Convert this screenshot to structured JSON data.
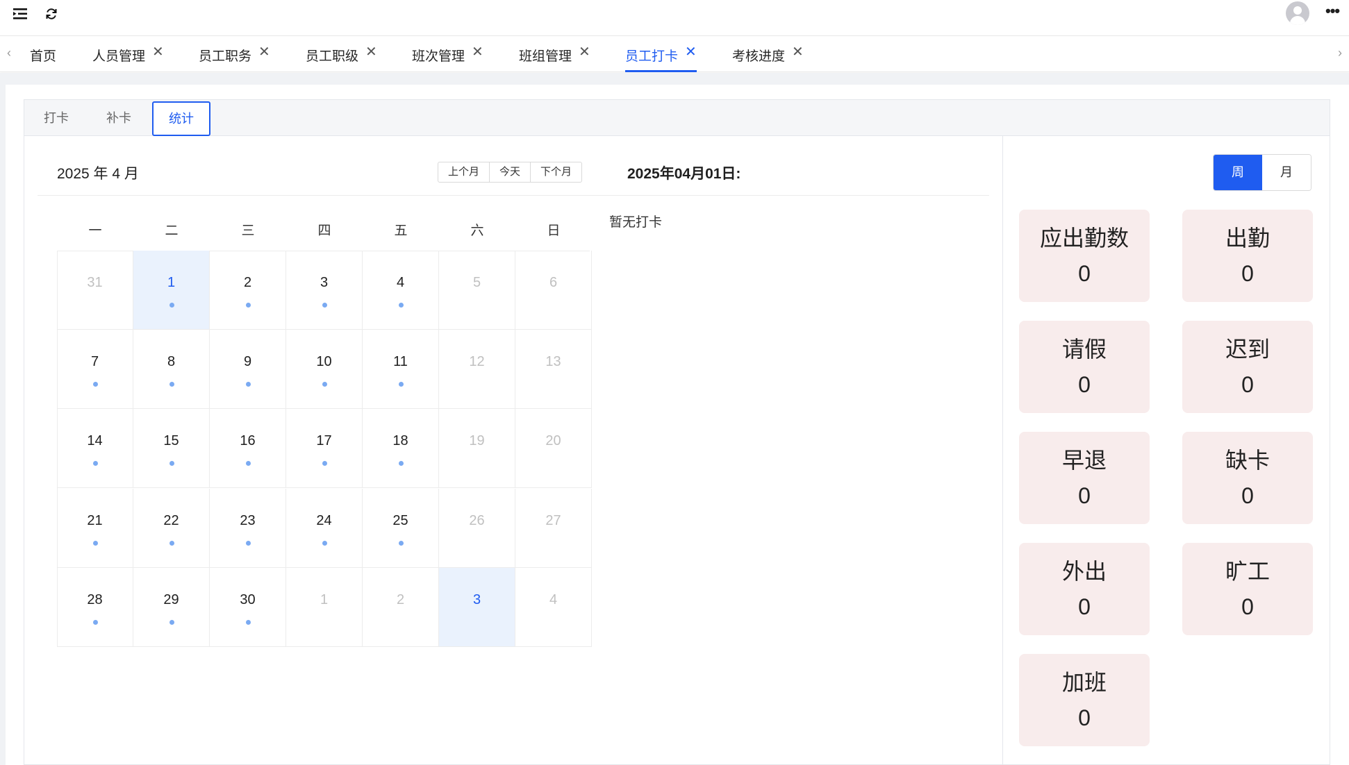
{
  "tabs": {
    "items": [
      {
        "label": "首页",
        "closable": false
      },
      {
        "label": "人员管理",
        "closable": true
      },
      {
        "label": "员工职务",
        "closable": true
      },
      {
        "label": "员工职级",
        "closable": true
      },
      {
        "label": "班次管理",
        "closable": true
      },
      {
        "label": "班组管理",
        "closable": true
      },
      {
        "label": "员工打卡",
        "closable": true,
        "active": true
      },
      {
        "label": "考核进度",
        "closable": true
      }
    ],
    "close_glyph": "✕",
    "prev_glyph": "‹",
    "next_glyph": "›"
  },
  "subtabs": [
    "打卡",
    "补卡",
    "统计"
  ],
  "subtab_active": "统计",
  "calendar": {
    "title": "2025 年 4 月",
    "prev_label": "上个月",
    "today_label": "今天",
    "next_label": "下个月",
    "weekdays": [
      "一",
      "二",
      "三",
      "四",
      "五",
      "六",
      "日"
    ],
    "weeks": [
      [
        {
          "d": "31",
          "muted": true
        },
        {
          "d": "1",
          "dot": true,
          "selected": true
        },
        {
          "d": "2",
          "dot": true
        },
        {
          "d": "3",
          "dot": true
        },
        {
          "d": "4",
          "dot": true
        },
        {
          "d": "5",
          "muted": true
        },
        {
          "d": "6",
          "muted": true
        }
      ],
      [
        {
          "d": "7",
          "dot": true
        },
        {
          "d": "8",
          "dot": true
        },
        {
          "d": "9",
          "dot": true
        },
        {
          "d": "10",
          "dot": true
        },
        {
          "d": "11",
          "dot": true
        },
        {
          "d": "12",
          "muted": true
        },
        {
          "d": "13",
          "muted": true
        }
      ],
      [
        {
          "d": "14",
          "dot": true
        },
        {
          "d": "15",
          "dot": true
        },
        {
          "d": "16",
          "dot": true
        },
        {
          "d": "17",
          "dot": true
        },
        {
          "d": "18",
          "dot": true
        },
        {
          "d": "19",
          "muted": true
        },
        {
          "d": "20",
          "muted": true
        }
      ],
      [
        {
          "d": "21",
          "dot": true
        },
        {
          "d": "22",
          "dot": true
        },
        {
          "d": "23",
          "dot": true
        },
        {
          "d": "24",
          "dot": true
        },
        {
          "d": "25",
          "dot": true
        },
        {
          "d": "26",
          "muted": true
        },
        {
          "d": "27",
          "muted": true
        }
      ],
      [
        {
          "d": "28",
          "dot": true
        },
        {
          "d": "29",
          "dot": true
        },
        {
          "d": "30",
          "dot": true
        },
        {
          "d": "1",
          "muted": true
        },
        {
          "d": "2",
          "muted": true
        },
        {
          "d": "3",
          "muted": true,
          "selected": true
        },
        {
          "d": "4",
          "muted": true
        }
      ]
    ]
  },
  "detail": {
    "date_title": "2025年04月01日:",
    "empty_text": "暂无打卡"
  },
  "stats": {
    "period_options": [
      "周",
      "月"
    ],
    "period_active": "周",
    "cards": [
      {
        "label": "应出勤数",
        "value": "0"
      },
      {
        "label": "出勤",
        "value": "0"
      },
      {
        "label": "请假",
        "value": "0"
      },
      {
        "label": "迟到",
        "value": "0"
      },
      {
        "label": "早退",
        "value": "0"
      },
      {
        "label": "缺卡",
        "value": "0"
      },
      {
        "label": "外出",
        "value": "0"
      },
      {
        "label": "旷工",
        "value": "0"
      },
      {
        "label": "加班",
        "value": "0"
      }
    ]
  },
  "colors": {
    "accent": "#1f5cf0",
    "card_bg": "#f8ecec",
    "selected_day_bg": "#eaf2fd",
    "dot": "#7aaaf2"
  }
}
